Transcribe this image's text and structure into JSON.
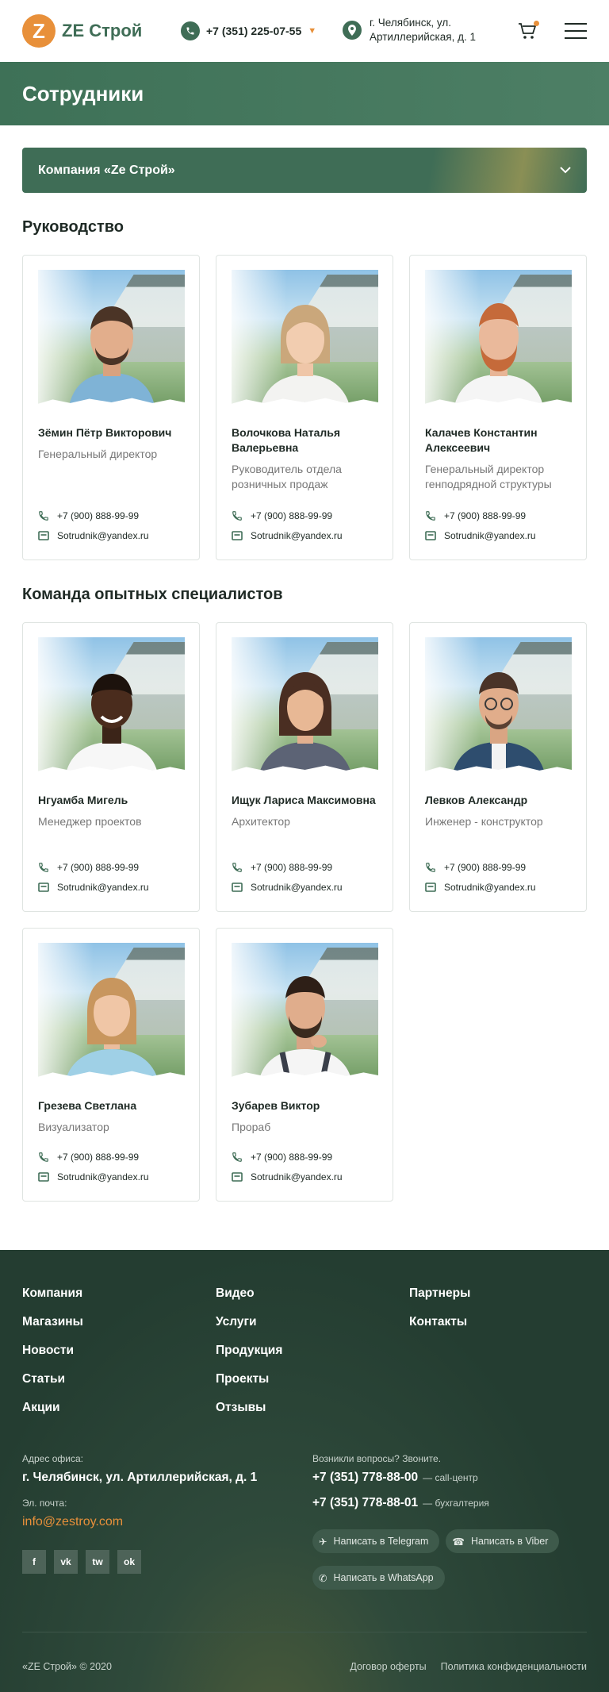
{
  "header": {
    "logo_letter": "Z",
    "logo_text": "ZE Строй",
    "phone": "+7 (351) 225-07-55",
    "address": "г. Челябинск, ул. Артиллерийская, д. 1",
    "accent_color": "#e8903a",
    "brand_color": "#3f6d56"
  },
  "page": {
    "title": "Сотрудники",
    "company_select": "Компания «Ze Строй»"
  },
  "sections": [
    {
      "title": "Руководство",
      "employees": [
        {
          "name": "Зёмин Пётр Викторович",
          "role": "Генеральный директор",
          "phone": "+7 (900) 888-99-99",
          "email": "Sotrudnik@yandex.ru"
        },
        {
          "name": "Волочкова Наталья Валерьевна",
          "role": "Руководитель отдела розничных продаж",
          "phone": "+7 (900) 888-99-99",
          "email": "Sotrudnik@yandex.ru"
        },
        {
          "name": "Калачев Константин Алексеевич",
          "role": "Генеральный директор генподрядной структуры",
          "phone": "+7 (900) 888-99-99",
          "email": "Sotrudnik@yandex.ru"
        }
      ]
    },
    {
      "title": "Команда опытных специалистов",
      "employees": [
        {
          "name": "Нгуамба Мигель",
          "role": "Менеджер проектов",
          "phone": "+7 (900) 888-99-99",
          "email": "Sotrudnik@yandex.ru"
        },
        {
          "name": "Ищук Лариса Максимовна",
          "role": "Архитектор",
          "phone": "+7 (900) 888-99-99",
          "email": "Sotrudnik@yandex.ru"
        },
        {
          "name": "Левков Александр",
          "role": "Инженер - конструктор",
          "phone": "+7 (900) 888-99-99",
          "email": "Sotrudnik@yandex.ru"
        },
        {
          "name": "Грезева Светлана",
          "role": "Визуализатор",
          "phone": "+7 (900) 888-99-99",
          "email": "Sotrudnik@yandex.ru"
        },
        {
          "name": "Зубарев Виктор",
          "role": "Прораб",
          "phone": "+7 (900) 888-99-99",
          "email": "Sotrudnik@yandex.ru"
        }
      ]
    }
  ],
  "footer": {
    "nav_cols": [
      [
        "Компания",
        "Магазины",
        "Новости",
        "Статьи",
        "Акции"
      ],
      [
        "Видео",
        "Услуги",
        "Продукция",
        "Проекты",
        "Отзывы"
      ],
      [
        "Партнеры",
        "Контакты"
      ]
    ],
    "office_label": "Адрес офиса:",
    "office_address": "г. Челябинск, ул. Артиллерийская, д. 1",
    "email_label": "Эл. почта:",
    "email": "info@zestroy.com",
    "social": [
      "f",
      "vk",
      "tw",
      "ok"
    ],
    "questions_label": "Возникли вопросы? Звоните.",
    "phones": [
      {
        "number": "+7 (351) 778-88-00",
        "note": "— call-центр"
      },
      {
        "number": "+7 (351) 778-88-01",
        "note": "— бухгалтерия"
      }
    ],
    "messengers": [
      "Написать в Telegram",
      "Написать в Viber",
      "Написать в WhatsApp"
    ],
    "copyright": "«ZE Строй» © 2020",
    "links": [
      "Договор оферты",
      "Политика конфиденциальности"
    ]
  }
}
